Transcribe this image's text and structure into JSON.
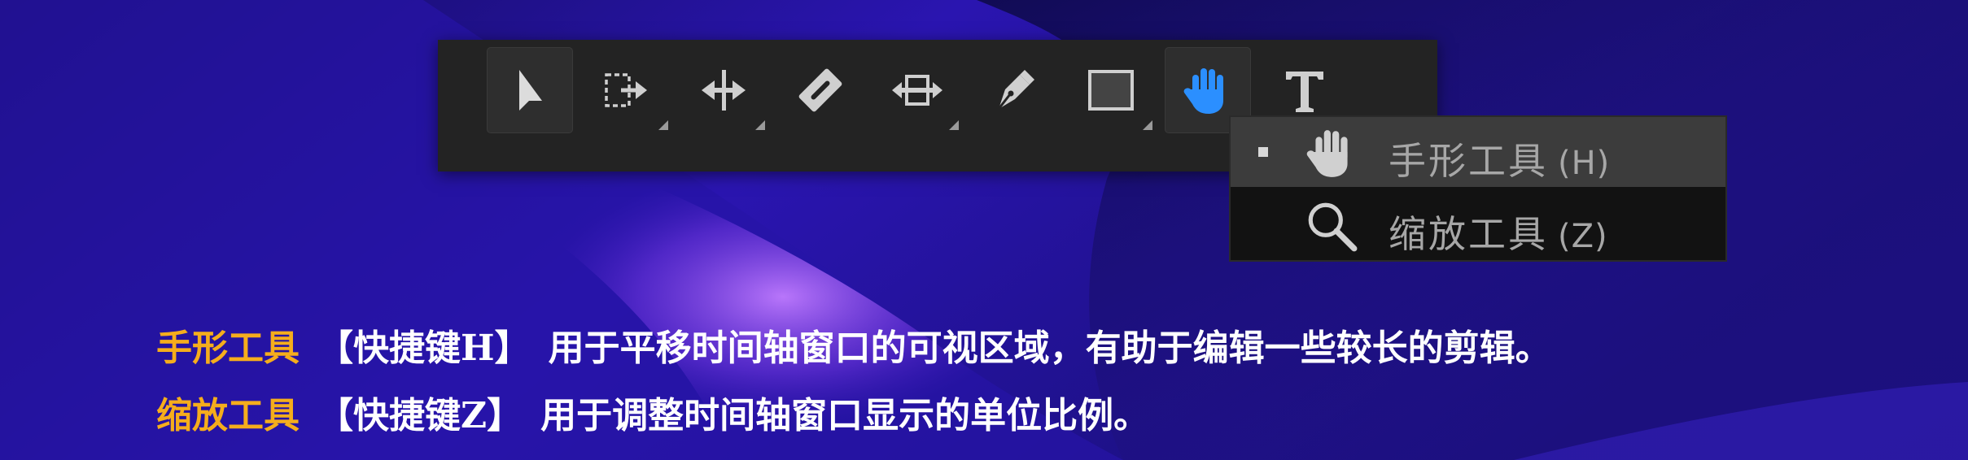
{
  "toolbar": {
    "tools": [
      {
        "icon": "selection-arrow-icon",
        "active": true
      },
      {
        "icon": "track-select-forward-icon",
        "has_submenu": true
      },
      {
        "icon": "ripple-edit-icon",
        "has_submenu": true
      },
      {
        "icon": "razor-icon"
      },
      {
        "icon": "slip-icon",
        "has_submenu": true
      },
      {
        "icon": "pen-icon"
      },
      {
        "icon": "rectangle-icon",
        "has_submenu": true
      },
      {
        "icon": "hand-icon",
        "active": true,
        "color": "#2b8fff"
      },
      {
        "icon": "text-icon"
      }
    ]
  },
  "dropdown": {
    "items": [
      {
        "icon": "hand-icon",
        "label": "手形工具",
        "shortcut": "(H)",
        "selected": true
      },
      {
        "icon": "zoom-magnifier-icon",
        "label": "缩放工具",
        "shortcut": "(Z)",
        "selected": false
      }
    ]
  },
  "captions": [
    {
      "tool": "手形工具",
      "shortcut": "【快捷键H】",
      "text": "用于平移时间轴窗口的可视区域，有助于编辑一些较长的剪辑。"
    },
    {
      "tool": "缩放工具",
      "shortcut": "【快捷键Z】",
      "text": "用于调整时间轴窗口显示的单位比例。"
    }
  ],
  "colors": {
    "accent_orange": "#f5ad1c",
    "active_blue": "#2b8fff",
    "toolbar_bg": "#232323",
    "dropdown_bg": "#121212",
    "dropdown_selected": "#3c3c3c"
  }
}
